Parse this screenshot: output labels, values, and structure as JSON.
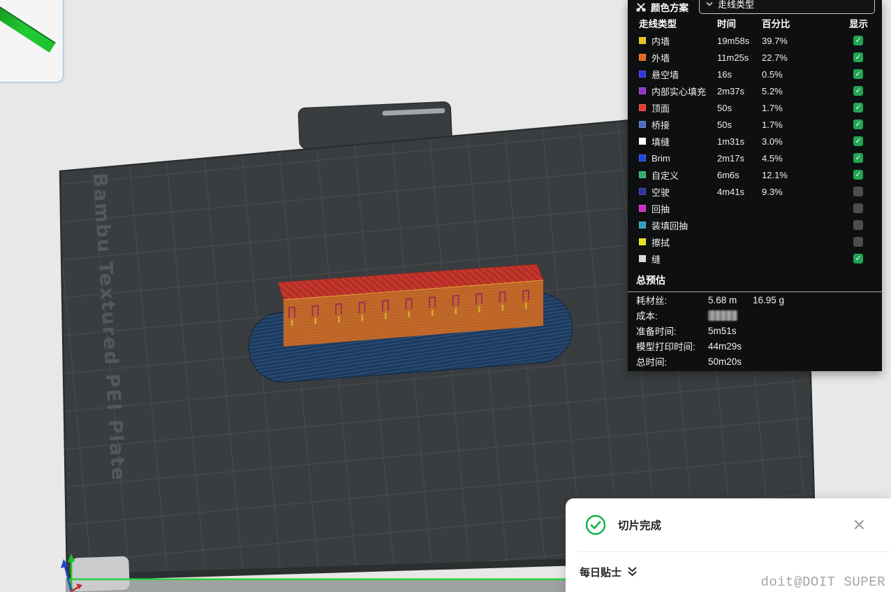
{
  "plate": {
    "label": "Bambu Textured PEI Plate"
  },
  "legend_panel": {
    "header": {
      "title": "颜色方案",
      "dropdown_value": "走线类型"
    },
    "columns": {
      "type": "走线类型",
      "time": "时间",
      "percent": "百分比",
      "show": "显示"
    },
    "rows": [
      {
        "label": "内墙",
        "color": "#E2C41E",
        "time": "19m58s",
        "percent": "39.7%",
        "visible": true
      },
      {
        "label": "外墙",
        "color": "#E8671E",
        "time": "11m25s",
        "percent": "22.7%",
        "visible": true
      },
      {
        "label": "悬空墙",
        "color": "#3336E0",
        "time": "16s",
        "percent": "0.5%",
        "visible": true
      },
      {
        "label": "内部实心填充",
        "color": "#9332C8",
        "time": "2m37s",
        "percent": "5.2%",
        "visible": true
      },
      {
        "label": "顶面",
        "color": "#E23A30",
        "time": "50s",
        "percent": "1.7%",
        "visible": true
      },
      {
        "label": "桥接",
        "color": "#4C6FC4",
        "time": "50s",
        "percent": "1.7%",
        "visible": true
      },
      {
        "label": "填缝",
        "color": "#FFFFFF",
        "time": "1m31s",
        "percent": "3.0%",
        "visible": true
      },
      {
        "label": "Brim",
        "color": "#1F46DE",
        "time": "2m17s",
        "percent": "4.5%",
        "visible": true
      },
      {
        "label": "自定义",
        "color": "#2FAE70",
        "time": "6m6s",
        "percent": "12.1%",
        "visible": true
      },
      {
        "label": "空驶",
        "color": "#2F2FA8",
        "time": "4m41s",
        "percent": "9.3%",
        "visible": false
      },
      {
        "label": "回抽",
        "color": "#CF2CC6",
        "time": "",
        "percent": "",
        "visible": false
      },
      {
        "label": "装填回抽",
        "color": "#2E9FBE",
        "time": "",
        "percent": "",
        "visible": false
      },
      {
        "label": "擦拭",
        "color": "#E3E31F",
        "time": "",
        "percent": "",
        "visible": false
      },
      {
        "label": "缝",
        "color": "#D9D9D9",
        "time": "",
        "percent": "",
        "visible": true
      }
    ],
    "estimate": {
      "title": "总预估",
      "rows": [
        {
          "label": "耗材丝:",
          "values": [
            "5.68 m",
            "16.95 g"
          ],
          "redacted": false
        },
        {
          "label": "成本:",
          "values": [],
          "redacted": true
        },
        {
          "label": "准备时间:",
          "values": [
            "5m51s"
          ],
          "redacted": false
        },
        {
          "label": "模型打印时间:",
          "values": [
            "44m29s"
          ],
          "redacted": false
        },
        {
          "label": "总时间:",
          "values": [
            "50m20s"
          ],
          "redacted": false
        }
      ]
    }
  },
  "notification": {
    "title": "切片完成",
    "close_glyph": "✕",
    "tip_label": "每日贴士"
  },
  "watermark": "doit@DOIT SUPER"
}
